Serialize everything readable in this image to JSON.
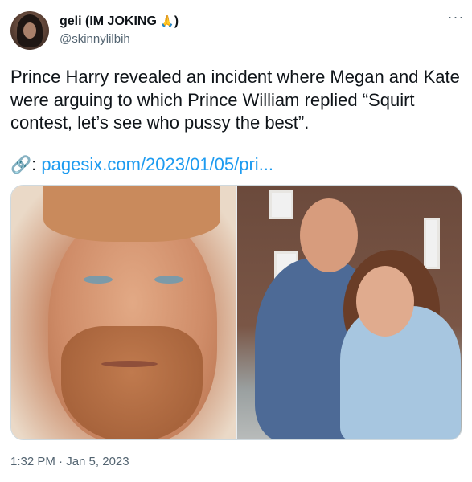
{
  "tweet": {
    "author": {
      "display_name": "geli (IM JOKING ",
      "display_name_emoji": "🙏",
      "display_name_suffix": ")",
      "handle": "@skinnylilbih"
    },
    "more_label": "···",
    "text": "Prince Harry revealed an incident where Megan and Kate were arguing to which Prince William replied “Squirt contest, let’s see who pussy the best”.",
    "link": {
      "icon": "🔗",
      "colon": ":",
      "url_text": "pagesix.com/2023/01/05/pri..."
    },
    "media": {
      "images": [
        {
          "icon": "photo-prince-harry"
        },
        {
          "icon": "photo-william-and-kate"
        }
      ]
    },
    "timestamp": "1:32 PM · Jan 5, 2023"
  },
  "colors": {
    "link": "#1d9bf0",
    "text": "#0f1419",
    "secondary": "#536471"
  }
}
